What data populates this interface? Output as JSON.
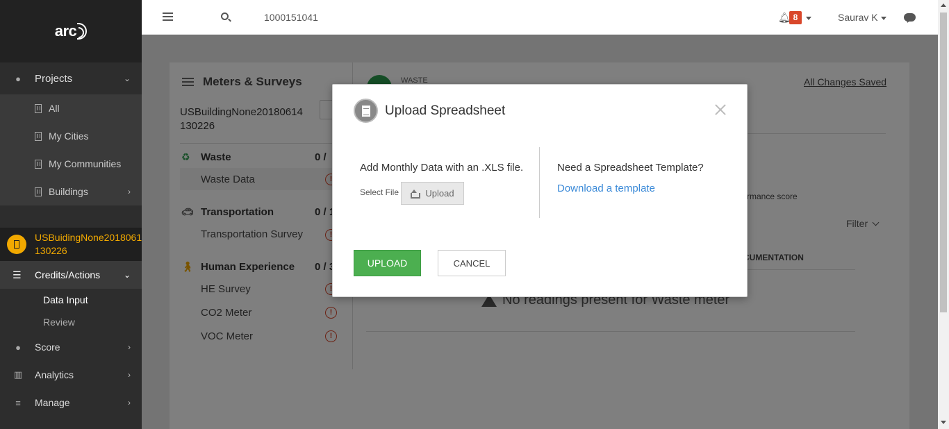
{
  "app": {
    "logo": "arc"
  },
  "topbar": {
    "search_value": "1000151041",
    "notification_count": "8",
    "user_name": "Saurav K"
  },
  "sidebar": {
    "projects_label": "Projects",
    "project_items": [
      {
        "label": "All"
      },
      {
        "label": "My Cities"
      },
      {
        "label": "My Communities"
      },
      {
        "label": "Buildings"
      }
    ],
    "building_name_line1": "USBuidingNone2018061",
    "building_name_line2": "130226",
    "credits_label": "Credits/Actions",
    "credits_items": [
      {
        "label": "Data Input"
      },
      {
        "label": "Review"
      }
    ],
    "score_label": "Score",
    "analytics_label": "Analytics",
    "manage_label": "Manage"
  },
  "panel": {
    "title": "Meters & Surveys",
    "building_line1": "USBuildingNone20180614",
    "building_line2": "130226",
    "categories": [
      {
        "label": "Waste",
        "count": "0 /",
        "items": [
          "Waste Data"
        ]
      },
      {
        "label": "Transportation",
        "count": "0 / 1",
        "items": [
          "Transportation Survey"
        ]
      },
      {
        "label": "Human Experience",
        "count": "0 / 3",
        "items": [
          "HE Survey",
          "CO2 Meter",
          "VOC Meter"
        ]
      }
    ],
    "waste_header": "WASTE",
    "saved_text": "All Changes Saved",
    "performance_text": "rmance score",
    "filter_label": "Filter",
    "column_header": "CUMENTATION",
    "empty_text": "No readings present for Waste meter"
  },
  "modal": {
    "title": "Upload Spreadsheet",
    "add_text": "Add Monthly Data with an .XLS file.",
    "select_file_label": "Select File",
    "upload_file_button": "Upload",
    "need_template": "Need a Spreadsheet Template?",
    "download_link": "Download a template",
    "upload_button": "UPLOAD",
    "cancel_button": "CANCEL"
  },
  "colors": {
    "accent_green": "#4caf50",
    "link_blue": "#3b8ad8",
    "badge_red": "#d9472b",
    "building_orange": "#f2a900"
  }
}
